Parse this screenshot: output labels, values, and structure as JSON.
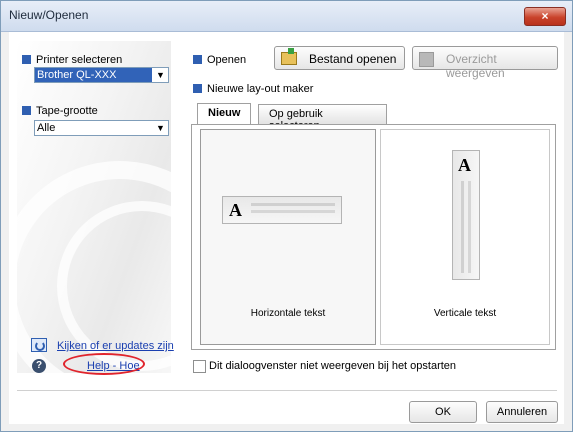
{
  "window": {
    "title": "Nieuw/Openen",
    "close_symbol": "×"
  },
  "left": {
    "printer_label": "Printer selecteren",
    "printer_value": "Brother QL-XXX",
    "tape_label": "Tape-grootte",
    "tape_value": "Alle",
    "updates_link": "Kijken of er updates zijn",
    "help_link": "Help - Hoe"
  },
  "top": {
    "open_label": "Openen",
    "open_file_button": "Bestand openen",
    "overview_button": "Overzicht weergeven",
    "new_layout_label": "Nieuwe lay-out maker"
  },
  "tabs": [
    {
      "label": "Nieuw",
      "active": true
    },
    {
      "label": "Op gebruik selecteren",
      "active": false
    }
  ],
  "layouts": {
    "horizontal_caption": "Horizontale tekst",
    "vertical_caption": "Verticale tekst",
    "sample_letter": "A"
  },
  "footer": {
    "checkbox_label": "Dit dialoogvenster niet weergeven bij het opstarten",
    "checkbox_checked": false,
    "ok_button": "OK",
    "cancel_button": "Annuleren"
  },
  "colors": {
    "accent": "#2f5fb1",
    "selection": "#3163b8",
    "highlight_circle": "#e0242c",
    "close_button": "#c9432b"
  },
  "icons": [
    "combo-arrow-icon",
    "folder-open-icon",
    "overview-icon",
    "update-icon",
    "help-icon"
  ]
}
